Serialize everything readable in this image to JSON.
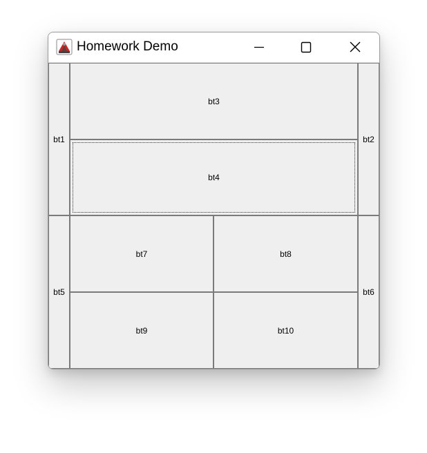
{
  "window": {
    "title": "Homework Demo"
  },
  "title_controls": {
    "minimize_icon": "minimize-icon",
    "maximize_icon": "maximize-icon",
    "close_icon": "close-icon"
  },
  "buttons": {
    "bt1": "bt1",
    "bt2": "bt2",
    "bt3": "bt3",
    "bt4": "bt4",
    "bt5": "bt5",
    "bt6": "bt6",
    "bt7": "bt7",
    "bt8": "bt8",
    "bt9": "bt9",
    "bt10": "bt10"
  },
  "focused_button": "bt4"
}
